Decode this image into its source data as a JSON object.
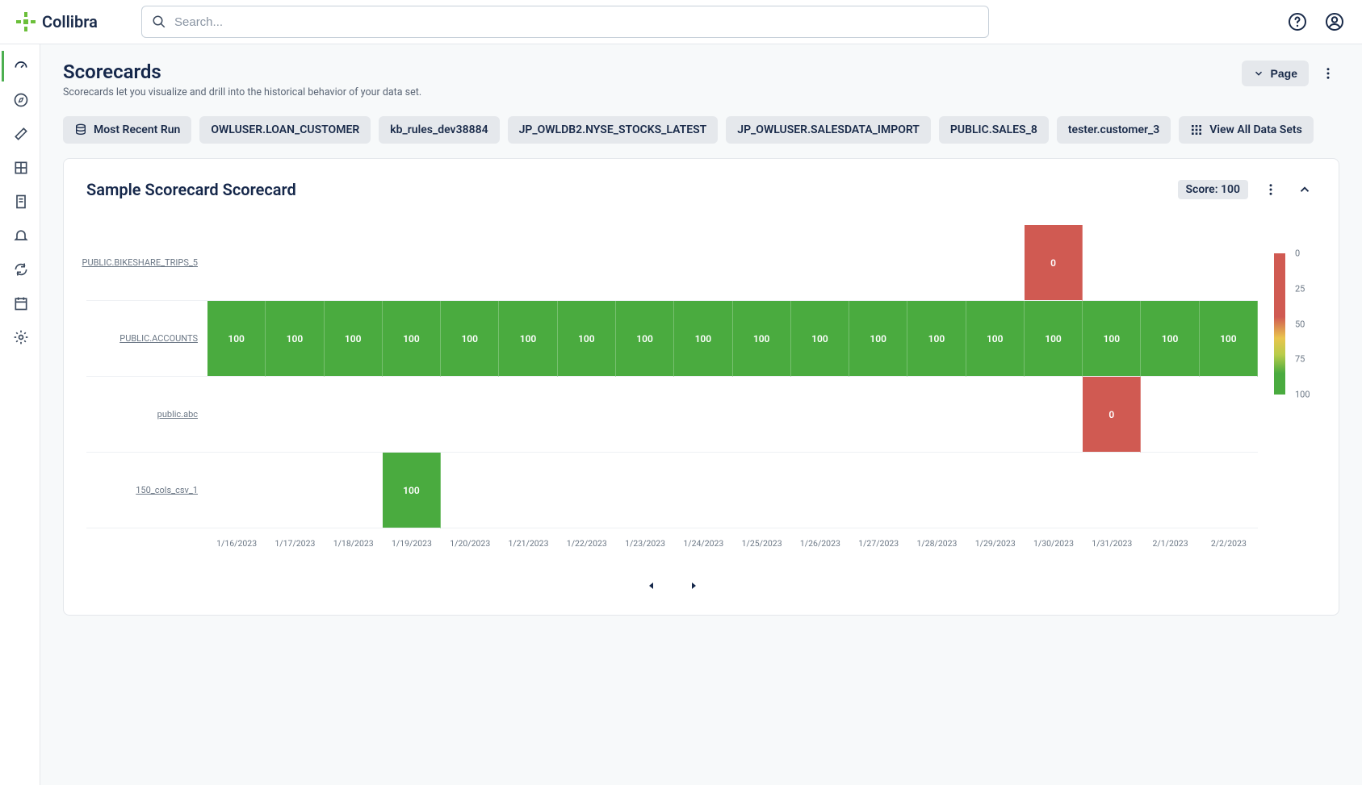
{
  "app_name": "Collibra",
  "search": {
    "placeholder": "Search..."
  },
  "page": {
    "title": "Scorecards",
    "subtitle": "Scorecards let you visualize and drill into the historical behavior of your data set.",
    "page_btn": "Page"
  },
  "chips": {
    "most_recent": "Most Recent Run",
    "items": [
      "OWLUSER.LOAN_CUSTOMER",
      "kb_rules_dev38884",
      "JP_OWLDB2.NYSE_STOCKS_LATEST",
      "JP_OWLUSER.SALESDATA_IMPORT",
      "PUBLIC.SALES_8",
      "tester.customer_3"
    ],
    "view_all": "View All Data Sets"
  },
  "card": {
    "title": "Sample Scorecard Scorecard",
    "score_label": "Score: 100"
  },
  "chart_data": {
    "type": "heatmap",
    "title": "Sample Scorecard Scorecard",
    "xlabel": "",
    "ylabel": "",
    "x": [
      "1/16/2023",
      "1/17/2023",
      "1/18/2023",
      "1/19/2023",
      "1/20/2023",
      "1/21/2023",
      "1/22/2023",
      "1/23/2023",
      "1/24/2023",
      "1/25/2023",
      "1/26/2023",
      "1/27/2023",
      "1/28/2023",
      "1/29/2023",
      "1/30/2023",
      "1/31/2023",
      "2/1/2023",
      "2/2/2023"
    ],
    "y": [
      "PUBLIC.BIKESHARE_TRIPS_5",
      "PUBLIC.ACCOUNTS",
      "public.abc",
      "150_cols_csv_1"
    ],
    "values": [
      [
        null,
        null,
        null,
        null,
        null,
        null,
        null,
        null,
        null,
        null,
        null,
        null,
        null,
        null,
        0,
        null,
        null,
        null
      ],
      [
        100,
        100,
        100,
        100,
        100,
        100,
        100,
        100,
        100,
        100,
        100,
        100,
        100,
        100,
        100,
        100,
        100,
        100
      ],
      [
        null,
        null,
        null,
        null,
        null,
        null,
        null,
        null,
        null,
        null,
        null,
        null,
        null,
        null,
        null,
        0,
        null,
        null
      ],
      [
        null,
        null,
        null,
        100,
        null,
        null,
        null,
        null,
        null,
        null,
        null,
        null,
        null,
        null,
        null,
        null,
        null,
        null
      ]
    ],
    "color_scale": {
      "min": 0,
      "max": 100,
      "ticks": [
        0,
        25,
        50,
        75,
        100
      ]
    },
    "colors": {
      "low": "#d05a52",
      "mid": "#e9c54d",
      "high": "#4aab3f"
    }
  }
}
